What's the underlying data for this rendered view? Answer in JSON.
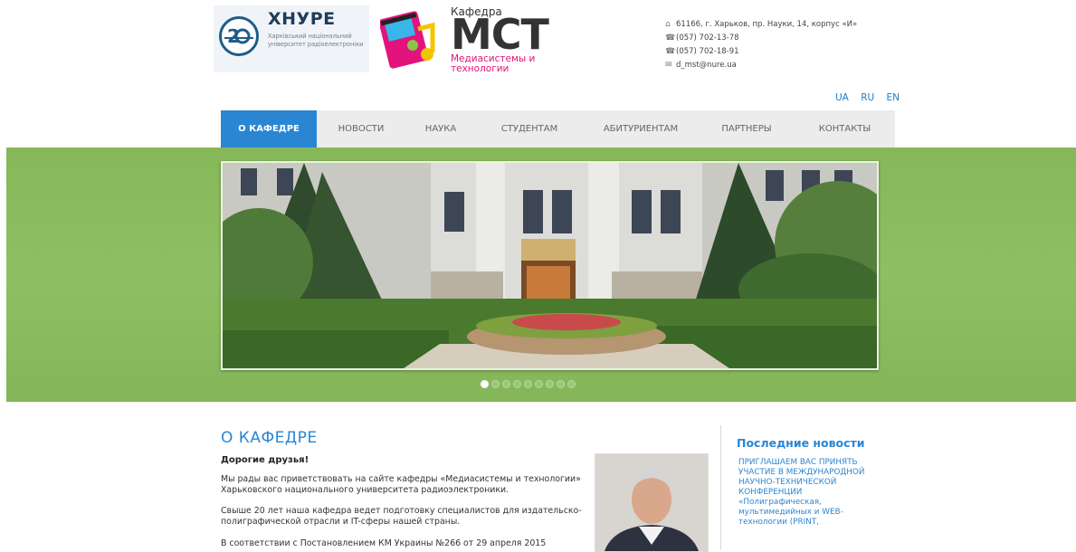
{
  "header": {
    "khnure": {
      "title": "ХНУРЕ",
      "subtitle": "Харківський національний університет радіоелектроніки"
    },
    "mst": {
      "kafedra": "Кафедра",
      "abbr": "МСТ",
      "subtitle": "Медиасистемы и технологии"
    },
    "contacts": {
      "address": "61166, г. Харьков, пр. Науки, 14, корпус «И»",
      "phone1": "(057) 702-13-78",
      "phone2": "(057) 702-18-91",
      "email": "d_mst@nure.ua"
    },
    "languages": [
      "UA",
      "RU",
      "EN"
    ]
  },
  "nav": {
    "items": [
      {
        "label": "О КАФЕДРЕ"
      },
      {
        "label": "НОВОСТИ"
      },
      {
        "label": "НАУКА"
      },
      {
        "label": "СТУДЕНТАМ"
      },
      {
        "label": "АБИТУРИЕНТАМ"
      },
      {
        "label": "ПАРТНЕРЫ"
      },
      {
        "label": "КОНТАКТЫ"
      }
    ],
    "active_index": 0
  },
  "slider": {
    "slide_count": 9,
    "current_slide": 1
  },
  "about": {
    "title": "О КАФЕДРЕ",
    "greeting": "Дорогие друзья!",
    "paragraphs": [
      "Мы рады вас приветствовать на сайте кафедры «Медиасистемы и технологии» Харьковского национального университета радиоэлектроники.",
      "Свыше 20 лет наша кафедра ведет подготовку специалистов для издательско-полиграфической отрасли и IT-сферы нашей страны.",
      "В соответствии с Постановлением КМ Украины №266 от 29 апреля 2015"
    ]
  },
  "news": {
    "title": "Последние новости",
    "item1": "ПРИГЛАШАЕМ ВАС ПРИНЯТЬ УЧАСТИЕ В МЕЖДУНАРОДНОЙ НАУЧНО-ТЕХНИЧЕСКОЙ КОНФЕРЕНЦИИ «Полиграфическая, мультимедийных и WEB-технологии (PRINT,"
  },
  "colors": {
    "accent": "#2a86d3",
    "banner_green": "#86b85a",
    "mst_pink": "#e2137d",
    "nav_bg": "#ececec"
  },
  "icons": [
    "home-icon",
    "phone-icon",
    "phone-icon",
    "mail-icon"
  ]
}
